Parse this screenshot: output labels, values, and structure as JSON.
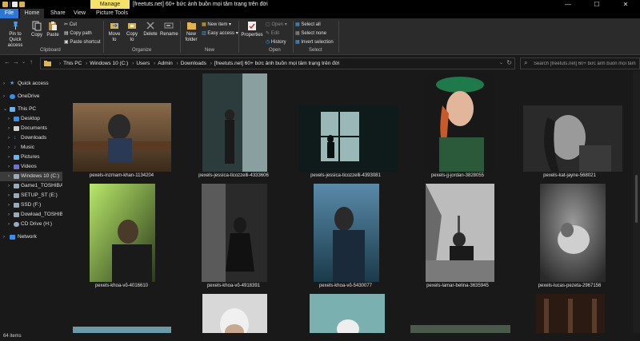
{
  "window": {
    "manage_tab": "Manage",
    "title": "[freetuts.net] 60+ bức ảnh buồn mọi tâm trạng trên đời",
    "minimize": "—",
    "maximize": "☐",
    "close": "✕"
  },
  "menu": {
    "file": "File",
    "home": "Home",
    "share": "Share",
    "view": "View",
    "picture_tools": "Picture Tools"
  },
  "ribbon": {
    "pin": "Pin to Quick access",
    "copy": "Copy",
    "paste": "Paste",
    "cut": "Cut",
    "copy_path": "Copy path",
    "paste_shortcut": "Paste shortcut",
    "clipboard_group": "Clipboard",
    "move_to": "Move to",
    "copy_to": "Copy to",
    "delete": "Delete",
    "rename": "Rename",
    "organize_group": "Organize",
    "new_folder": "New folder",
    "new_item": "New item ▾",
    "easy_access": "Easy access ▾",
    "new_group": "New",
    "properties": "Properties",
    "open": "Open ▾",
    "edit": "Edit",
    "history": "History",
    "open_group": "Open",
    "select_all": "Select all",
    "select_none": "Select none",
    "invert_selection": "Invert selection",
    "select_group": "Select"
  },
  "address": {
    "crumbs": [
      "This PC",
      "Windows 10 (C:)",
      "Users",
      "Admin",
      "Downloads",
      "[freetuts.net] 60+ bức ảnh buồn mọi tâm trạng trên đời"
    ],
    "search_placeholder": "Search [freetuts.net] 60+ bức ảnh buồn mọi tâm trạ..."
  },
  "nav": [
    {
      "label": "Quick access",
      "icon": "star-icon",
      "color": "#3a8ee6"
    },
    {
      "label": "OneDrive",
      "icon": "cloud-icon",
      "color": "#3a8ee6"
    },
    {
      "label": "This PC",
      "icon": "computer-icon",
      "color": "#6fb3e6"
    },
    {
      "label": "Desktop",
      "icon": "desktop-icon",
      "color": "#3a8ee6"
    },
    {
      "label": "Documents",
      "icon": "documents-icon",
      "color": "#cfcfcf"
    },
    {
      "label": "Downloads",
      "icon": "download-icon",
      "color": "#3a8ee6"
    },
    {
      "label": "Music",
      "icon": "music-icon",
      "color": "#3a8ee6"
    },
    {
      "label": "Pictures",
      "icon": "pictures-icon",
      "color": "#6fb3e6"
    },
    {
      "label": "Videos",
      "icon": "videos-icon",
      "color": "#6f6fd6"
    },
    {
      "label": "Windows 10 (C:)",
      "icon": "drive-icon",
      "color": "#9ab"
    },
    {
      "label": "Game1_TOSHIBA (D:)",
      "icon": "drive-icon",
      "color": "#9ab"
    },
    {
      "label": "SETUP_ST (E:)",
      "icon": "drive-icon",
      "color": "#9ab"
    },
    {
      "label": "SSD (F:)",
      "icon": "drive-icon",
      "color": "#9ab"
    },
    {
      "label": "Dowload_TOSHIBA",
      "icon": "drive-icon",
      "color": "#9ab"
    },
    {
      "label": "CD Drive (H:)",
      "icon": "cd-drive-icon",
      "color": "#9ab"
    },
    {
      "label": "Network",
      "icon": "network-icon",
      "color": "#3a8ee6"
    }
  ],
  "files": [
    {
      "name": "pexels-inzmam-khan-1134204"
    },
    {
      "name": "pexels-jessica-ticozzelli-4333606"
    },
    {
      "name": "pexels-jessica-ticozzelli-4393081"
    },
    {
      "name": "pexels-jj-jordan-3828055"
    },
    {
      "name": "pexels-kat-jayne-568021"
    },
    {
      "name": "pexels-khoa-võ-4016610"
    },
    {
      "name": "pexels-khoa-võ-4918391"
    },
    {
      "name": "pexels-khoa-võ-5430077"
    },
    {
      "name": "pexels-lamar-belina-3635945"
    },
    {
      "name": "pexels-lucas-pezeta-2967156"
    }
  ],
  "status": {
    "item_count": "64 items"
  }
}
